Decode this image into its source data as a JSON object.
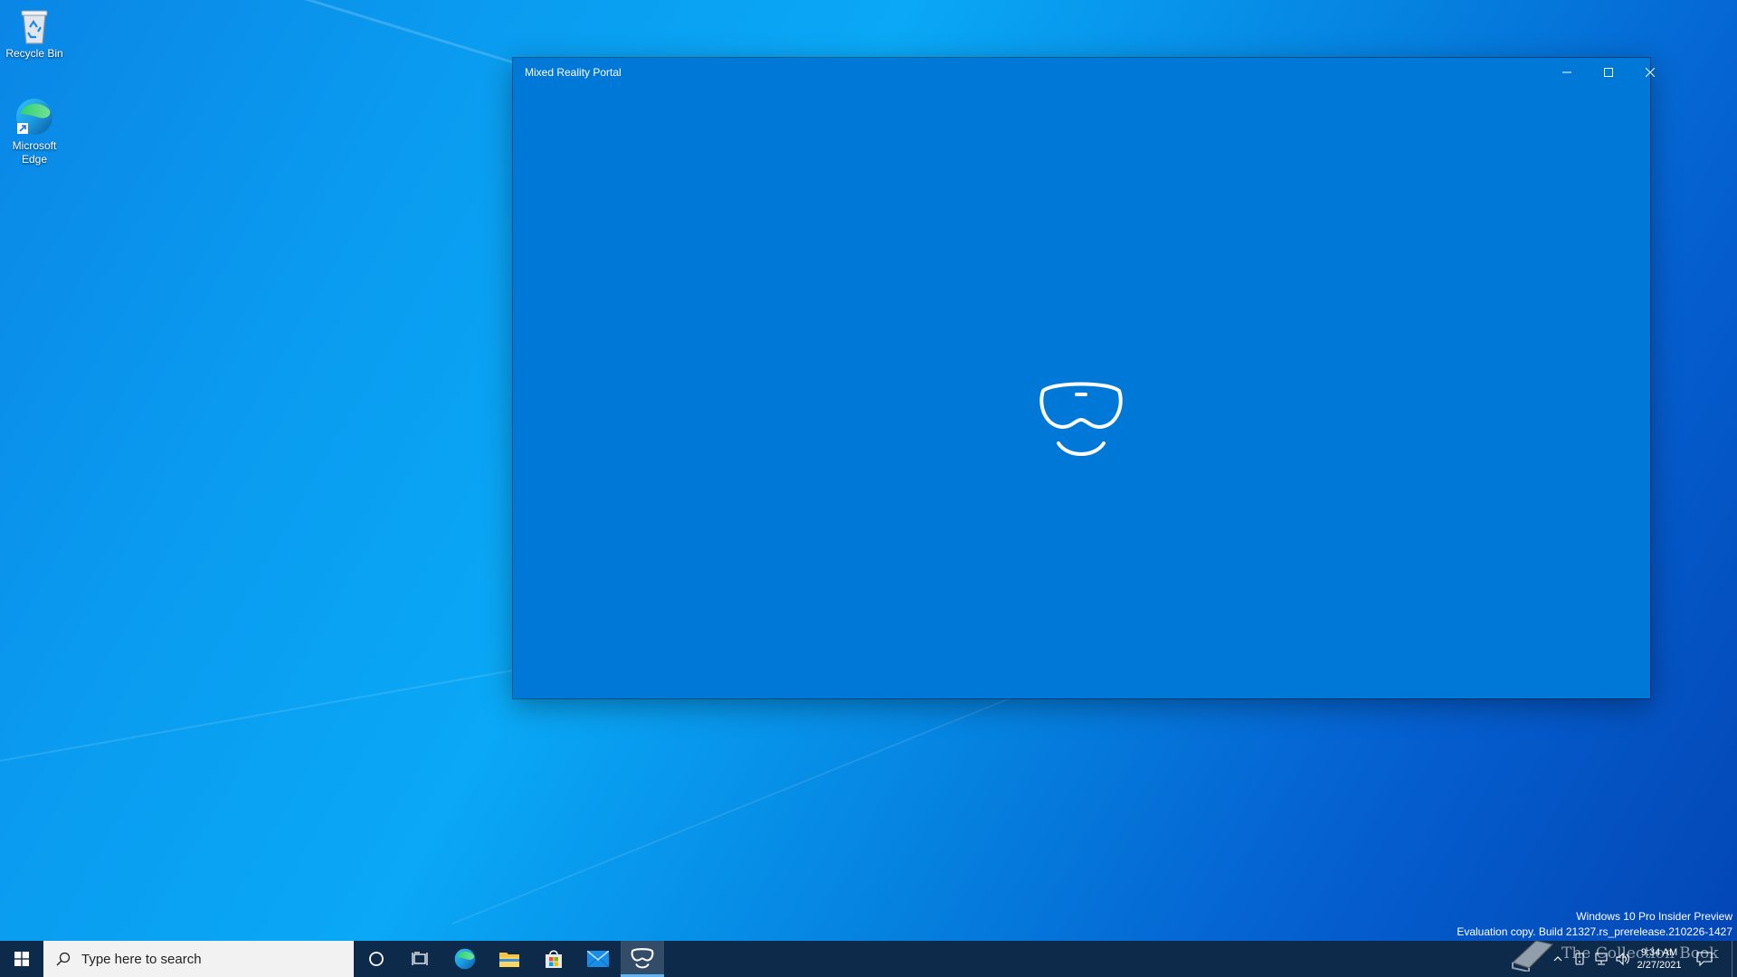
{
  "desktop": {
    "icons": [
      {
        "label": "Recycle Bin",
        "icon": "recycle-bin-icon"
      },
      {
        "label": "Microsoft Edge",
        "icon": "edge-icon"
      }
    ]
  },
  "window": {
    "title": "Mixed Reality Portal",
    "controls": {
      "minimize": "minimize-icon",
      "maximize": "maximize-icon",
      "close": "close-icon"
    },
    "background": "#0078d7",
    "logo": "mixed-reality-headset-icon"
  },
  "watermark": {
    "line1": "Windows 10 Pro Insider Preview",
    "line2": "Evaluation copy. Build 21327.rs_prerelease.210226-1427"
  },
  "taskbar": {
    "search_placeholder": "Type here to search",
    "pinned": [
      {
        "name": "edge",
        "icon": "edge-icon"
      },
      {
        "name": "file-explorer",
        "icon": "folder-icon"
      },
      {
        "name": "store",
        "icon": "store-icon"
      },
      {
        "name": "mail",
        "icon": "mail-icon"
      },
      {
        "name": "mixed-reality-portal",
        "icon": "mixed-reality-headset-icon",
        "active": true
      }
    ],
    "clock": {
      "time": "9:34 AM",
      "date": "2/27/2021"
    },
    "overlay_text": "The Collection Book",
    "background": "#0d2a4a"
  }
}
